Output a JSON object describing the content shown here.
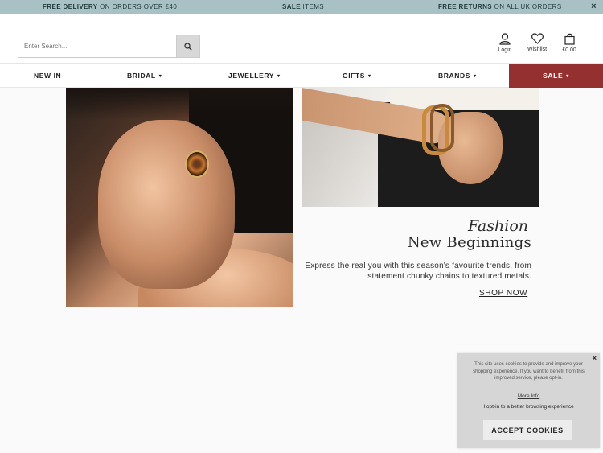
{
  "promo": {
    "delivery_bold": "FREE DELIVERY",
    "delivery_rest": " ON ORDERS OVER £40",
    "sale_bold": "SALE",
    "sale_rest": " ITEMS",
    "returns_bold": "FREE RETURNS",
    "returns_rest": " ON ALL UK ORDERS",
    "close": "×"
  },
  "header": {
    "search_placeholder": "Enter Search...",
    "login_label": "Login",
    "wishlist_label": "Wishlist",
    "basket_label": "£0.00"
  },
  "nav": {
    "new_in": "NEW IN",
    "bridal": "BRIDAL",
    "jewellery": "JEWELLERY",
    "gifts": "GIFTS",
    "brands": "BRANDS",
    "sale": "SALE",
    "caret": "▾"
  },
  "hero": {
    "title_line1": "Fashion",
    "title_line2": "New Beginnings",
    "description": "Express the real you with this season's favourite trends, from statement chunky chains to textured metals.",
    "cta": "SHOP NOW"
  },
  "cookie": {
    "close": "×",
    "text": "This site uses cookies to provide and improve your shopping experience. If you want to benefit from this improved service, please opt-in.",
    "more_info": "More Info",
    "opt_in": "I opt-in to a better browsing experience",
    "accept": "ACCEPT COOKIES"
  },
  "colors": {
    "promo_bg": "#a9c1c4",
    "sale_bg": "#94302f",
    "cookie_bg": "#d6d6d6"
  }
}
